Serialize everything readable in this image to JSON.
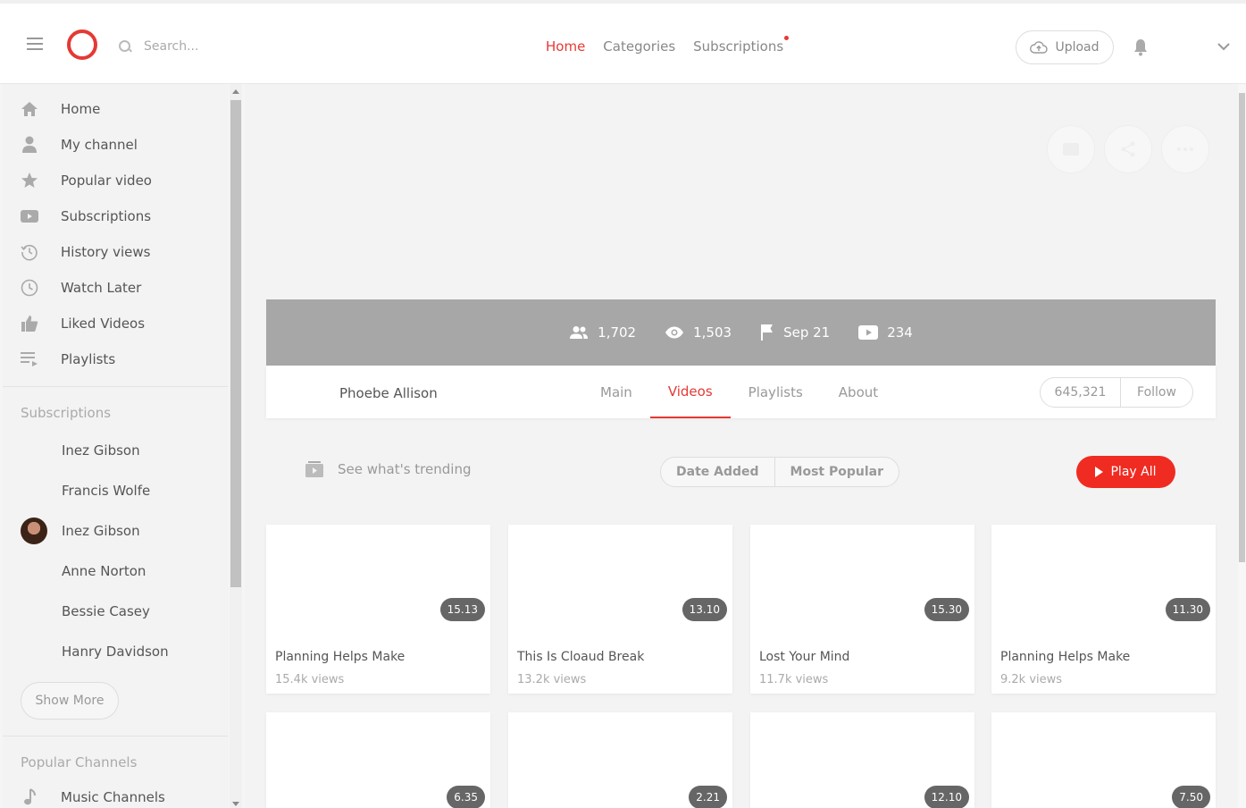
{
  "header": {
    "search_placeholder": "Search...",
    "nav": [
      {
        "label": "Home",
        "active": true
      },
      {
        "label": "Categories",
        "active": false
      },
      {
        "label": "Subscriptions",
        "active": false
      }
    ],
    "upload_label": "Upload"
  },
  "sidebar": {
    "items": [
      {
        "label": "Home",
        "icon": "home-icon"
      },
      {
        "label": "My channel",
        "icon": "user-icon"
      },
      {
        "label": "Popular video",
        "icon": "star-icon"
      },
      {
        "label": "Subscriptions",
        "icon": "youtube-icon"
      },
      {
        "label": "History views",
        "icon": "history-icon"
      },
      {
        "label": "Watch Later",
        "icon": "clock-icon"
      },
      {
        "label": "Liked Videos",
        "icon": "thumbs-up-icon"
      },
      {
        "label": "Playlists",
        "icon": "playlist-icon"
      }
    ],
    "subscriptions_title": "Subscriptions",
    "subscriptions": [
      {
        "name": "Inez Gibson"
      },
      {
        "name": "Francis Wolfe"
      },
      {
        "name": "Inez Gibson"
      },
      {
        "name": "Anne Norton"
      },
      {
        "name": "Bessie Casey"
      },
      {
        "name": "Hanry Davidson"
      }
    ],
    "show_more_label": "Show More",
    "popular_title": "Popular Channels",
    "popular": [
      {
        "label": "Music Channels",
        "icon": "music-note-icon"
      }
    ]
  },
  "channel": {
    "stats": {
      "subscribers": "1,702",
      "views": "1,503",
      "joined": "Sep 21",
      "videos": "234"
    },
    "name": "Phoebe Allison",
    "tabs": [
      {
        "label": "Main",
        "active": false
      },
      {
        "label": "Videos",
        "active": true
      },
      {
        "label": "Playlists",
        "active": false
      },
      {
        "label": "About",
        "active": false
      }
    ],
    "follow_count": "645,321",
    "follow_label": "Follow"
  },
  "toolbar": {
    "trending_label": "See what's trending",
    "sort": [
      "Date Added",
      "Most Popular"
    ],
    "play_all_label": "Play All"
  },
  "videos": [
    {
      "duration": "15.13",
      "title": "Planning Helps Make",
      "views": "15.4k views"
    },
    {
      "duration": "13.10",
      "title": "This Is Cloaud Break",
      "views": "13.2k views"
    },
    {
      "duration": "15.30",
      "title": "Lost Your Mind",
      "views": "11.7k views"
    },
    {
      "duration": "11.30",
      "title": "Planning Helps Make",
      "views": "9.2k views"
    },
    {
      "duration": "6.35",
      "title": "",
      "views": ""
    },
    {
      "duration": "2.21",
      "title": "",
      "views": ""
    },
    {
      "duration": "12.10",
      "title": "",
      "views": ""
    },
    {
      "duration": "7.50",
      "title": "",
      "views": ""
    }
  ],
  "colors": {
    "accent": "#e53935",
    "stats_bar": "#a7a7a7",
    "play_all": "#f02b22"
  }
}
